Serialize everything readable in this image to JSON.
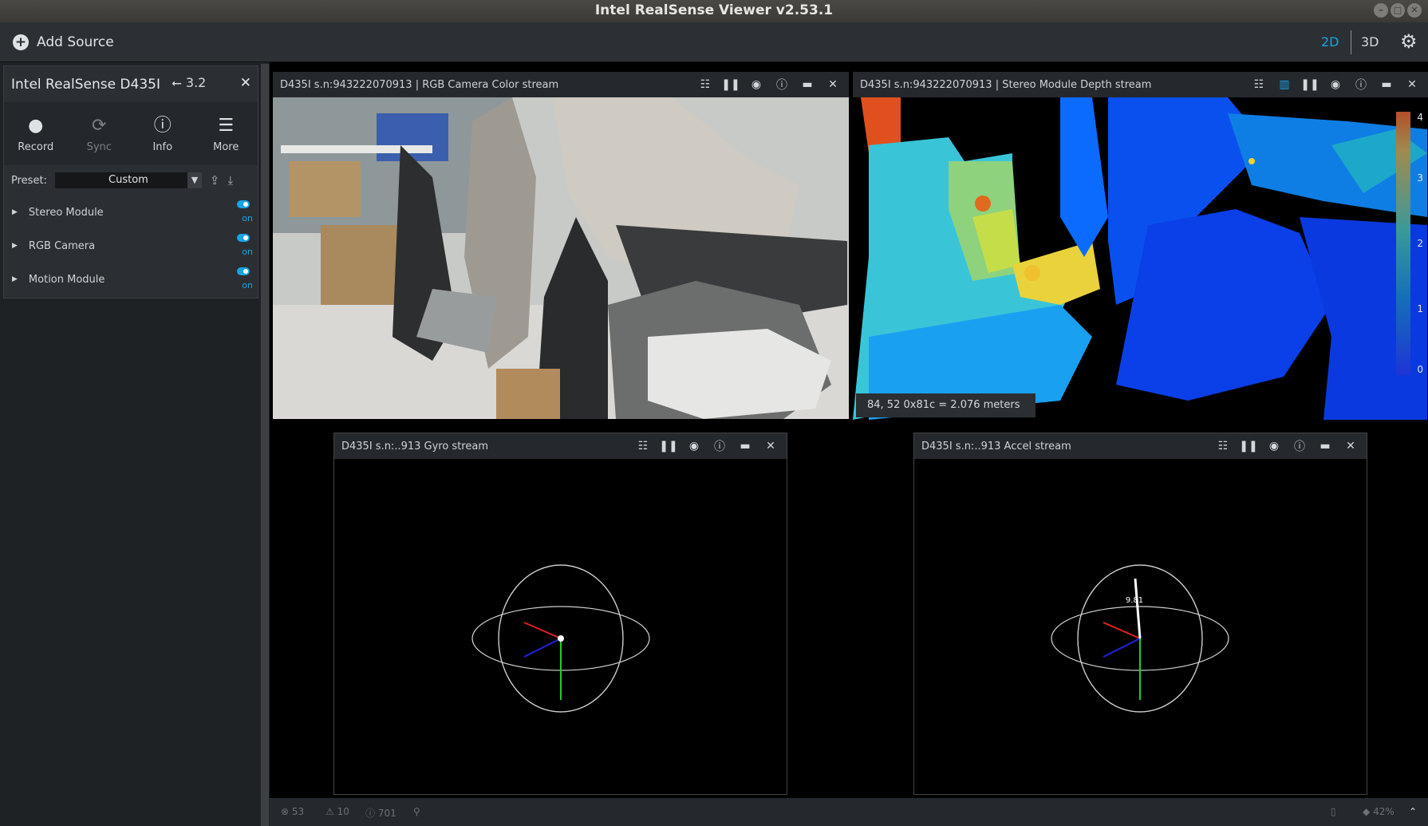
{
  "window": {
    "title": "Intel RealSense Viewer v2.53.1"
  },
  "sidebar": {
    "add_source": "Add Source",
    "device": {
      "name": "Intel RealSense D435I",
      "usb": "3.2",
      "buttons": [
        {
          "label": "Record",
          "icon": "record-icon"
        },
        {
          "label": "Sync",
          "icon": "sync-icon"
        },
        {
          "label": "Info",
          "icon": "info-icon"
        },
        {
          "label": "More",
          "icon": "menu-icon"
        }
      ],
      "preset_label": "Preset:",
      "preset_value": "Custom",
      "modules": [
        {
          "name": "Stereo Module",
          "state": "on"
        },
        {
          "name": "RGB Camera",
          "state": "on"
        },
        {
          "name": "Motion Module",
          "state": "on"
        }
      ]
    }
  },
  "topbar": {
    "view_2d": "2D",
    "view_3d": "3D"
  },
  "streams": {
    "color": {
      "title": "D435I s.n:943222070913 | RGB Camera Color stream"
    },
    "depth": {
      "title": "D435I s.n:943222070913 | Stereo Module Depth stream",
      "readout": "84, 52 0x81c = 2.076 meters",
      "scale": [
        "4",
        "3",
        "2",
        "1",
        "0"
      ]
    },
    "gyro": {
      "title": "D435I s.n:..913 Gyro stream"
    },
    "accel": {
      "title": "D435I s.n:..913 Accel stream",
      "value_label": "9.81"
    }
  },
  "status": {
    "errors": "53",
    "warnings": "10",
    "info": "701",
    "battery": "42%"
  },
  "colors": {
    "accent": "#1aa3e6",
    "panel": "#2b2f33"
  }
}
